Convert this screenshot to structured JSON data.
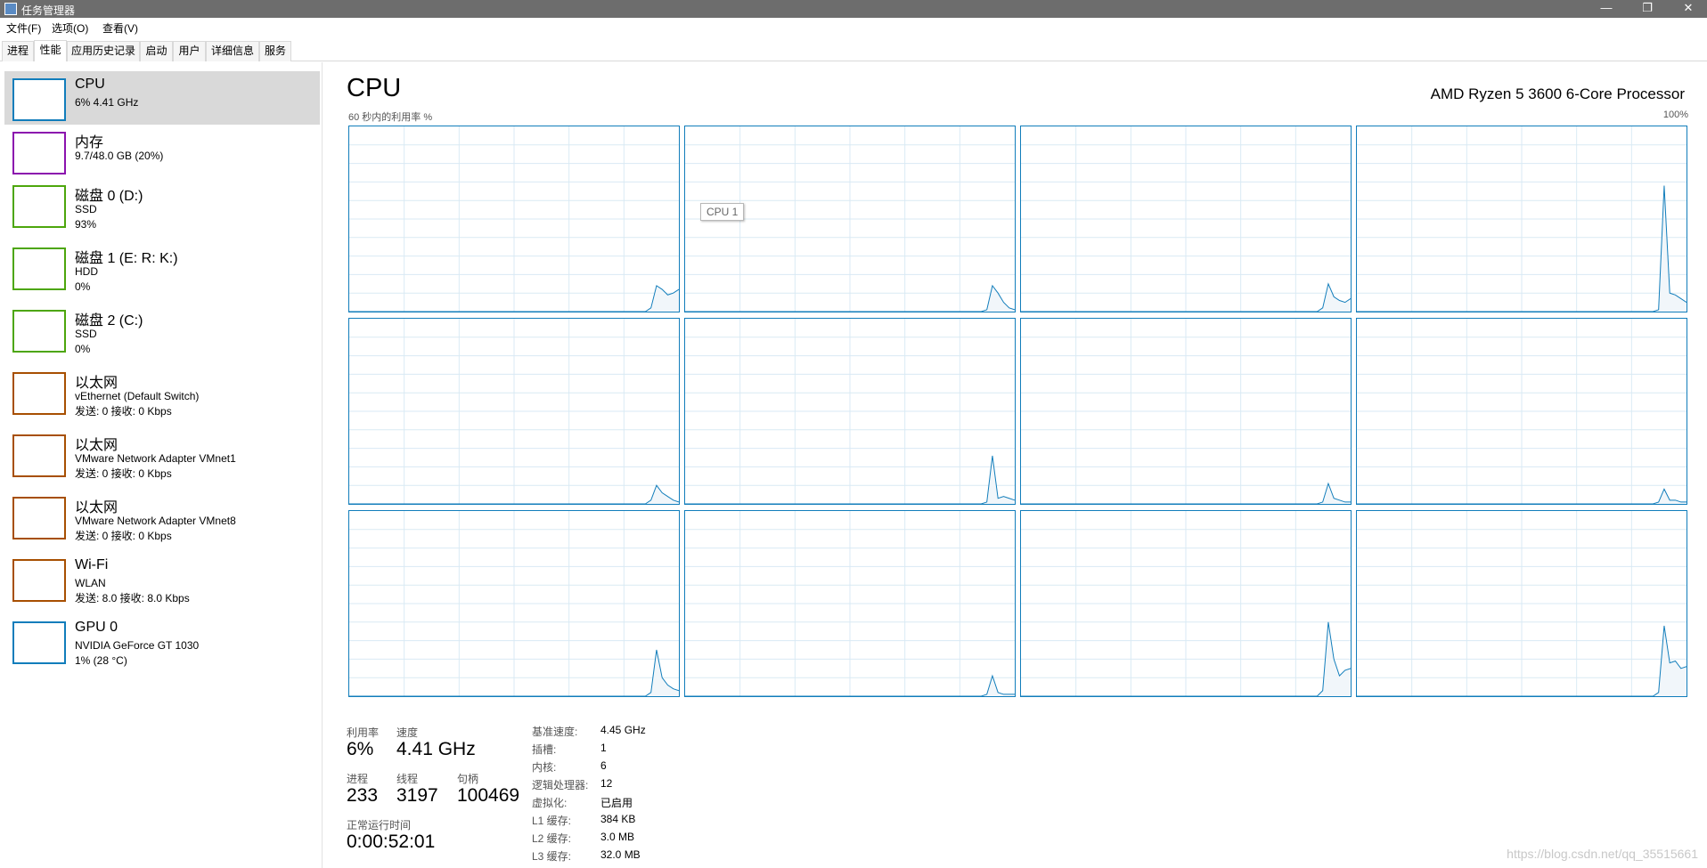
{
  "window": {
    "title": "任务管理器",
    "minimize_glyph": "—",
    "restore_glyph": "❐",
    "close_glyph": "✕"
  },
  "menu": [
    "文件(F)",
    "选项(O)",
    "查看(V)"
  ],
  "tabs": [
    "进程",
    "性能",
    "应用历史记录",
    "启动",
    "用户",
    "详细信息",
    "服务"
  ],
  "active_tab": 1,
  "sidebar": {
    "items": [
      {
        "name": "CPU",
        "lines": [
          "6% 4.41 GHz"
        ],
        "color": "#117dbb",
        "selected": true
      },
      {
        "name": "内存",
        "lines": [
          "9.7/48.0 GB (20%)"
        ],
        "color": "#8b12ae",
        "selected": false
      },
      {
        "name": "磁盘 0 (D:)",
        "lines": [
          "SSD",
          "93%"
        ],
        "color": "#4da60c",
        "selected": false
      },
      {
        "name": "磁盘 1 (E: R: K:)",
        "lines": [
          "HDD",
          "0%"
        ],
        "color": "#4da60c",
        "selected": false
      },
      {
        "name": "磁盘 2 (C:)",
        "lines": [
          "SSD",
          "0%"
        ],
        "color": "#4da60c",
        "selected": false
      },
      {
        "name": "以太网",
        "lines": [
          "vEthernet (Default Switch)",
          "发送: 0 接收: 0 Kbps"
        ],
        "color": "#a74f01",
        "selected": false
      },
      {
        "name": "以太网",
        "lines": [
          "VMware Network Adapter VMnet1",
          "发送: 0 接收: 0 Kbps"
        ],
        "color": "#a74f01",
        "selected": false
      },
      {
        "name": "以太网",
        "lines": [
          "VMware Network Adapter VMnet8",
          "发送: 0 接收: 0 Kbps"
        ],
        "color": "#a74f01",
        "selected": false
      },
      {
        "name": "Wi-Fi",
        "lines": [
          "WLAN",
          "发送: 8.0 接收: 8.0 Kbps"
        ],
        "color": "#a74f01",
        "selected": false
      },
      {
        "name": "GPU 0",
        "lines": [
          "NVIDIA GeForce GT 1030",
          "1% (28 °C)"
        ],
        "color": "#117dbb",
        "selected": false
      }
    ]
  },
  "main": {
    "title": "CPU",
    "processor": "AMD Ryzen 5 3600 6-Core Processor",
    "graph_label": "60 秒内的利用率 %",
    "graph_max": "100%",
    "tooltip": "CPU 1",
    "colors": {
      "line": "#117dbb",
      "fill": "#f1f6fa",
      "grid": "#d9eaf4"
    }
  },
  "chart_data": {
    "type": "area",
    "title": "60 秒内的利用率 %",
    "ylim": [
      0,
      100
    ],
    "grid": true,
    "series": [
      {
        "name": "CPU 0",
        "values": [
          0,
          0,
          0,
          0,
          0,
          0,
          0,
          0,
          0,
          0,
          0,
          0,
          0,
          0,
          0,
          0,
          0,
          0,
          0,
          0,
          0,
          0,
          0,
          0,
          0,
          0,
          0,
          0,
          0,
          0,
          0,
          0,
          0,
          0,
          0,
          0,
          0,
          0,
          0,
          0,
          0,
          0,
          0,
          0,
          0,
          0,
          0,
          0,
          0,
          0,
          0,
          0,
          0,
          0,
          2,
          14,
          12,
          9,
          10,
          12
        ]
      },
      {
        "name": "CPU 1",
        "values": [
          0,
          0,
          0,
          0,
          0,
          0,
          0,
          0,
          0,
          0,
          0,
          0,
          0,
          0,
          0,
          0,
          0,
          0,
          0,
          0,
          0,
          0,
          0,
          0,
          0,
          0,
          0,
          0,
          0,
          0,
          0,
          0,
          0,
          0,
          0,
          0,
          0,
          0,
          0,
          0,
          0,
          0,
          0,
          0,
          0,
          0,
          0,
          0,
          0,
          0,
          0,
          0,
          0,
          0,
          1,
          14,
          10,
          5,
          2,
          1
        ]
      },
      {
        "name": "CPU 2",
        "values": [
          0,
          0,
          0,
          0,
          0,
          0,
          0,
          0,
          0,
          0,
          0,
          0,
          0,
          0,
          0,
          0,
          0,
          0,
          0,
          0,
          0,
          0,
          0,
          0,
          0,
          0,
          0,
          0,
          0,
          0,
          0,
          0,
          0,
          0,
          0,
          0,
          0,
          0,
          0,
          0,
          0,
          0,
          0,
          0,
          0,
          0,
          0,
          0,
          0,
          0,
          0,
          0,
          0,
          0,
          2,
          15,
          8,
          6,
          5,
          7
        ]
      },
      {
        "name": "CPU 3",
        "values": [
          0,
          0,
          0,
          0,
          0,
          0,
          0,
          0,
          0,
          0,
          0,
          0,
          0,
          0,
          0,
          0,
          0,
          0,
          0,
          0,
          0,
          0,
          0,
          0,
          0,
          0,
          0,
          0,
          0,
          0,
          0,
          0,
          0,
          0,
          0,
          0,
          0,
          0,
          0,
          0,
          0,
          0,
          0,
          0,
          0,
          0,
          0,
          0,
          0,
          0,
          0,
          0,
          0,
          0,
          1,
          68,
          10,
          9,
          7,
          5
        ]
      },
      {
        "name": "CPU 4",
        "values": [
          0,
          0,
          0,
          0,
          0,
          0,
          0,
          0,
          0,
          0,
          0,
          0,
          0,
          0,
          0,
          0,
          0,
          0,
          0,
          0,
          0,
          0,
          0,
          0,
          0,
          0,
          0,
          0,
          0,
          0,
          0,
          0,
          0,
          0,
          0,
          0,
          0,
          0,
          0,
          0,
          0,
          0,
          0,
          0,
          0,
          0,
          0,
          0,
          0,
          0,
          0,
          0,
          0,
          0,
          2,
          10,
          6,
          4,
          2,
          1
        ]
      },
      {
        "name": "CPU 5",
        "values": [
          0,
          0,
          0,
          0,
          0,
          0,
          0,
          0,
          0,
          0,
          0,
          0,
          0,
          0,
          0,
          0,
          0,
          0,
          0,
          0,
          0,
          0,
          0,
          0,
          0,
          0,
          0,
          0,
          0,
          0,
          0,
          0,
          0,
          0,
          0,
          0,
          0,
          0,
          0,
          0,
          0,
          0,
          0,
          0,
          0,
          0,
          0,
          0,
          0,
          0,
          0,
          0,
          0,
          0,
          1,
          26,
          3,
          4,
          3,
          2
        ]
      },
      {
        "name": "CPU 6",
        "values": [
          0,
          0,
          0,
          0,
          0,
          0,
          0,
          0,
          0,
          0,
          0,
          0,
          0,
          0,
          0,
          0,
          0,
          0,
          0,
          0,
          0,
          0,
          0,
          0,
          0,
          0,
          0,
          0,
          0,
          0,
          0,
          0,
          0,
          0,
          0,
          0,
          0,
          0,
          0,
          0,
          0,
          0,
          0,
          0,
          0,
          0,
          0,
          0,
          0,
          0,
          0,
          0,
          0,
          0,
          1,
          11,
          3,
          2,
          1,
          1
        ]
      },
      {
        "name": "CPU 7",
        "values": [
          0,
          0,
          0,
          0,
          0,
          0,
          0,
          0,
          0,
          0,
          0,
          0,
          0,
          0,
          0,
          0,
          0,
          0,
          0,
          0,
          0,
          0,
          0,
          0,
          0,
          0,
          0,
          0,
          0,
          0,
          0,
          0,
          0,
          0,
          0,
          0,
          0,
          0,
          0,
          0,
          0,
          0,
          0,
          0,
          0,
          0,
          0,
          0,
          0,
          0,
          0,
          0,
          0,
          0,
          1,
          8,
          2,
          2,
          1,
          1
        ]
      },
      {
        "name": "CPU 8",
        "values": [
          0,
          0,
          0,
          0,
          0,
          0,
          0,
          0,
          0,
          0,
          0,
          0,
          0,
          0,
          0,
          0,
          0,
          0,
          0,
          0,
          0,
          0,
          0,
          0,
          0,
          0,
          0,
          0,
          0,
          0,
          0,
          0,
          0,
          0,
          0,
          0,
          0,
          0,
          0,
          0,
          0,
          0,
          0,
          0,
          0,
          0,
          0,
          0,
          0,
          0,
          0,
          0,
          0,
          0,
          2,
          25,
          10,
          6,
          4,
          3
        ]
      },
      {
        "name": "CPU 9",
        "values": [
          0,
          0,
          0,
          0,
          0,
          0,
          0,
          0,
          0,
          0,
          0,
          0,
          0,
          0,
          0,
          0,
          0,
          0,
          0,
          0,
          0,
          0,
          0,
          0,
          0,
          0,
          0,
          0,
          0,
          0,
          0,
          0,
          0,
          0,
          0,
          0,
          0,
          0,
          0,
          0,
          0,
          0,
          0,
          0,
          0,
          0,
          0,
          0,
          0,
          0,
          0,
          0,
          0,
          0,
          1,
          11,
          2,
          1,
          1,
          1
        ]
      },
      {
        "name": "CPU 10",
        "values": [
          0,
          0,
          0,
          0,
          0,
          0,
          0,
          0,
          0,
          0,
          0,
          0,
          0,
          0,
          0,
          0,
          0,
          0,
          0,
          0,
          0,
          0,
          0,
          0,
          0,
          0,
          0,
          0,
          0,
          0,
          0,
          0,
          0,
          0,
          0,
          0,
          0,
          0,
          0,
          0,
          0,
          0,
          0,
          0,
          0,
          0,
          0,
          0,
          0,
          0,
          0,
          0,
          0,
          0,
          3,
          40,
          20,
          11,
          14,
          15
        ]
      },
      {
        "name": "CPU 11",
        "values": [
          0,
          0,
          0,
          0,
          0,
          0,
          0,
          0,
          0,
          0,
          0,
          0,
          0,
          0,
          0,
          0,
          0,
          0,
          0,
          0,
          0,
          0,
          0,
          0,
          0,
          0,
          0,
          0,
          0,
          0,
          0,
          0,
          0,
          0,
          0,
          0,
          0,
          0,
          0,
          0,
          0,
          0,
          0,
          0,
          0,
          0,
          0,
          0,
          0,
          0,
          0,
          0,
          0,
          0,
          2,
          38,
          18,
          19,
          15,
          16
        ]
      }
    ]
  },
  "stats": {
    "util_label": "利用率",
    "util_value": "6%",
    "speed_label": "速度",
    "speed_value": "4.41 GHz",
    "proc_label": "进程",
    "proc_value": "233",
    "threads_label": "线程",
    "threads_value": "3197",
    "handles_label": "句柄",
    "handles_value": "100469",
    "uptime_label": "正常运行时间",
    "uptime_value": "0:00:52:01"
  },
  "specs": [
    {
      "key": "基准速度:",
      "value": "4.45 GHz"
    },
    {
      "key": "插槽:",
      "value": "1"
    },
    {
      "key": "内核:",
      "value": "6"
    },
    {
      "key": "逻辑处理器:",
      "value": "12"
    },
    {
      "key": "虚拟化:",
      "value": "已启用"
    },
    {
      "key": "L1 缓存:",
      "value": "384 KB"
    },
    {
      "key": "L2 缓存:",
      "value": "3.0 MB"
    },
    {
      "key": "L3 缓存:",
      "value": "32.0 MB"
    }
  ],
  "watermark": "https://blog.csdn.net/qq_35515661"
}
